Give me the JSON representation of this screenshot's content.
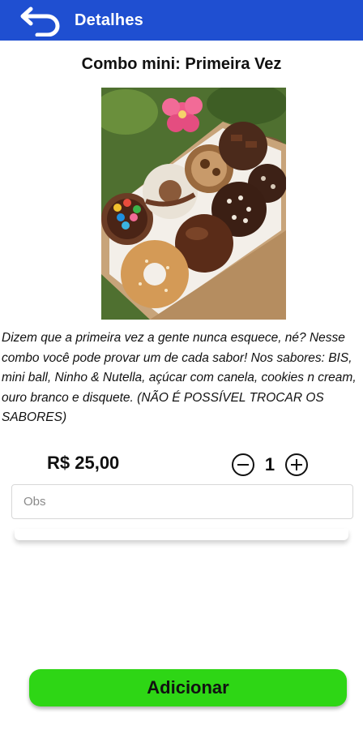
{
  "app_bar": {
    "title": "Detalhes",
    "back_icon": "back-arrow-icon",
    "background_color": "#1f4fd1"
  },
  "product": {
    "title": "Combo mini: Primeira Vez",
    "image_alt": "Caixa com donuts variados",
    "description": "Dizem que a primeira vez a gente nunca esquece, né? Nesse combo você pode provar um de cada sabor! Nos sabores: BIS, mini ball, Ninho & Nutella, açúcar com canela, cookies n cream, ouro branco e disquete. (NÃO É POSSÍVEL TROCAR OS SABORES)",
    "price": "R$ 25,00"
  },
  "quantity": {
    "value": "1",
    "decrement_icon": "minus-circle-icon",
    "increment_icon": "plus-circle-icon"
  },
  "obs": {
    "placeholder": "Obs",
    "value": ""
  },
  "actions": {
    "add_label": "Adicionar",
    "add_color": "#2ed615"
  }
}
